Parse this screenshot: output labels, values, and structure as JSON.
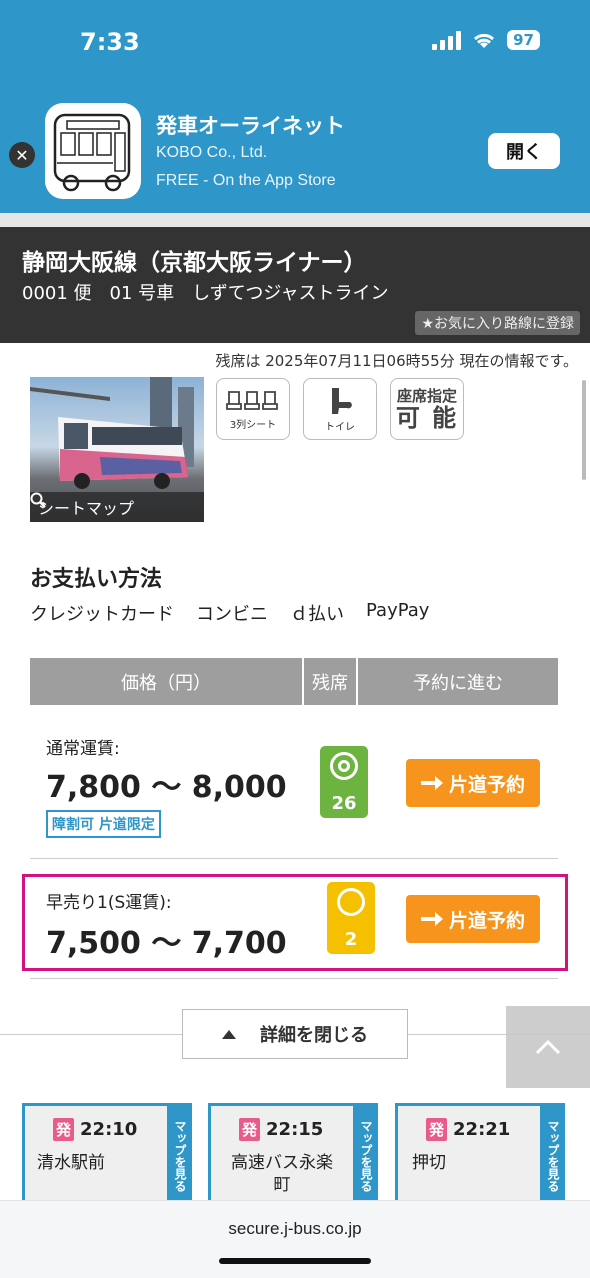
{
  "status": {
    "time": "7:33",
    "battery": "97"
  },
  "banner": {
    "app_name": "発車オーライネット",
    "company": "KOBO Co., Ltd.",
    "store_line": "FREE - On the App Store",
    "open_label": "開く",
    "close_icon": "close-icon"
  },
  "route": {
    "title": "静岡大阪線（京都大阪ライナー）",
    "subtitle": "0001 便　01 号車　しずてつジャストライン",
    "favorite_label": "★お気に入り路線に登録"
  },
  "seat_info": "残席は 2025年07月11日06時55分 現在の情報です。",
  "bus": {
    "seatmap_label": "シートマップ",
    "features": {
      "seat3": "3列シート",
      "toilet": "トイレ",
      "reserve_line1": "座席指定",
      "reserve_line2": "可 能"
    }
  },
  "payment": {
    "title": "お支払い方法",
    "methods": [
      "クレジットカード",
      "コンビニ",
      "ｄ払い",
      "PayPay"
    ]
  },
  "table": {
    "headers": [
      "価格（円）",
      "残席",
      "予約に進む"
    ],
    "rows": [
      {
        "label": "通常運賃:",
        "price": "7,800 〜 8,000",
        "badge": "障割可 片道限定",
        "seats": "26",
        "seat_color": "#6db33f",
        "button": "片道予約"
      },
      {
        "label": "早売り1(S運賃):",
        "price": "7,500 〜 7,700",
        "seats": "2",
        "seat_color": "#f5c000",
        "button": "片道予約"
      }
    ]
  },
  "detail_toggle": "詳細を閉じる",
  "stops": [
    {
      "dep_mark": "発",
      "time": "22:10",
      "name": "清水駅前",
      "map": "マップを見る"
    },
    {
      "dep_mark": "発",
      "time": "22:15",
      "name": "高速バス永楽町",
      "map": "マップを見る"
    },
    {
      "dep_mark": "発",
      "time": "22:21",
      "name": "押切",
      "map": "マップを見る"
    }
  ],
  "browser": {
    "url": "secure.j-bus.co.jp"
  },
  "colors": {
    "brand_blue": "#2e96c8",
    "book_orange": "#f7941d",
    "highlight": "#d0137f"
  }
}
